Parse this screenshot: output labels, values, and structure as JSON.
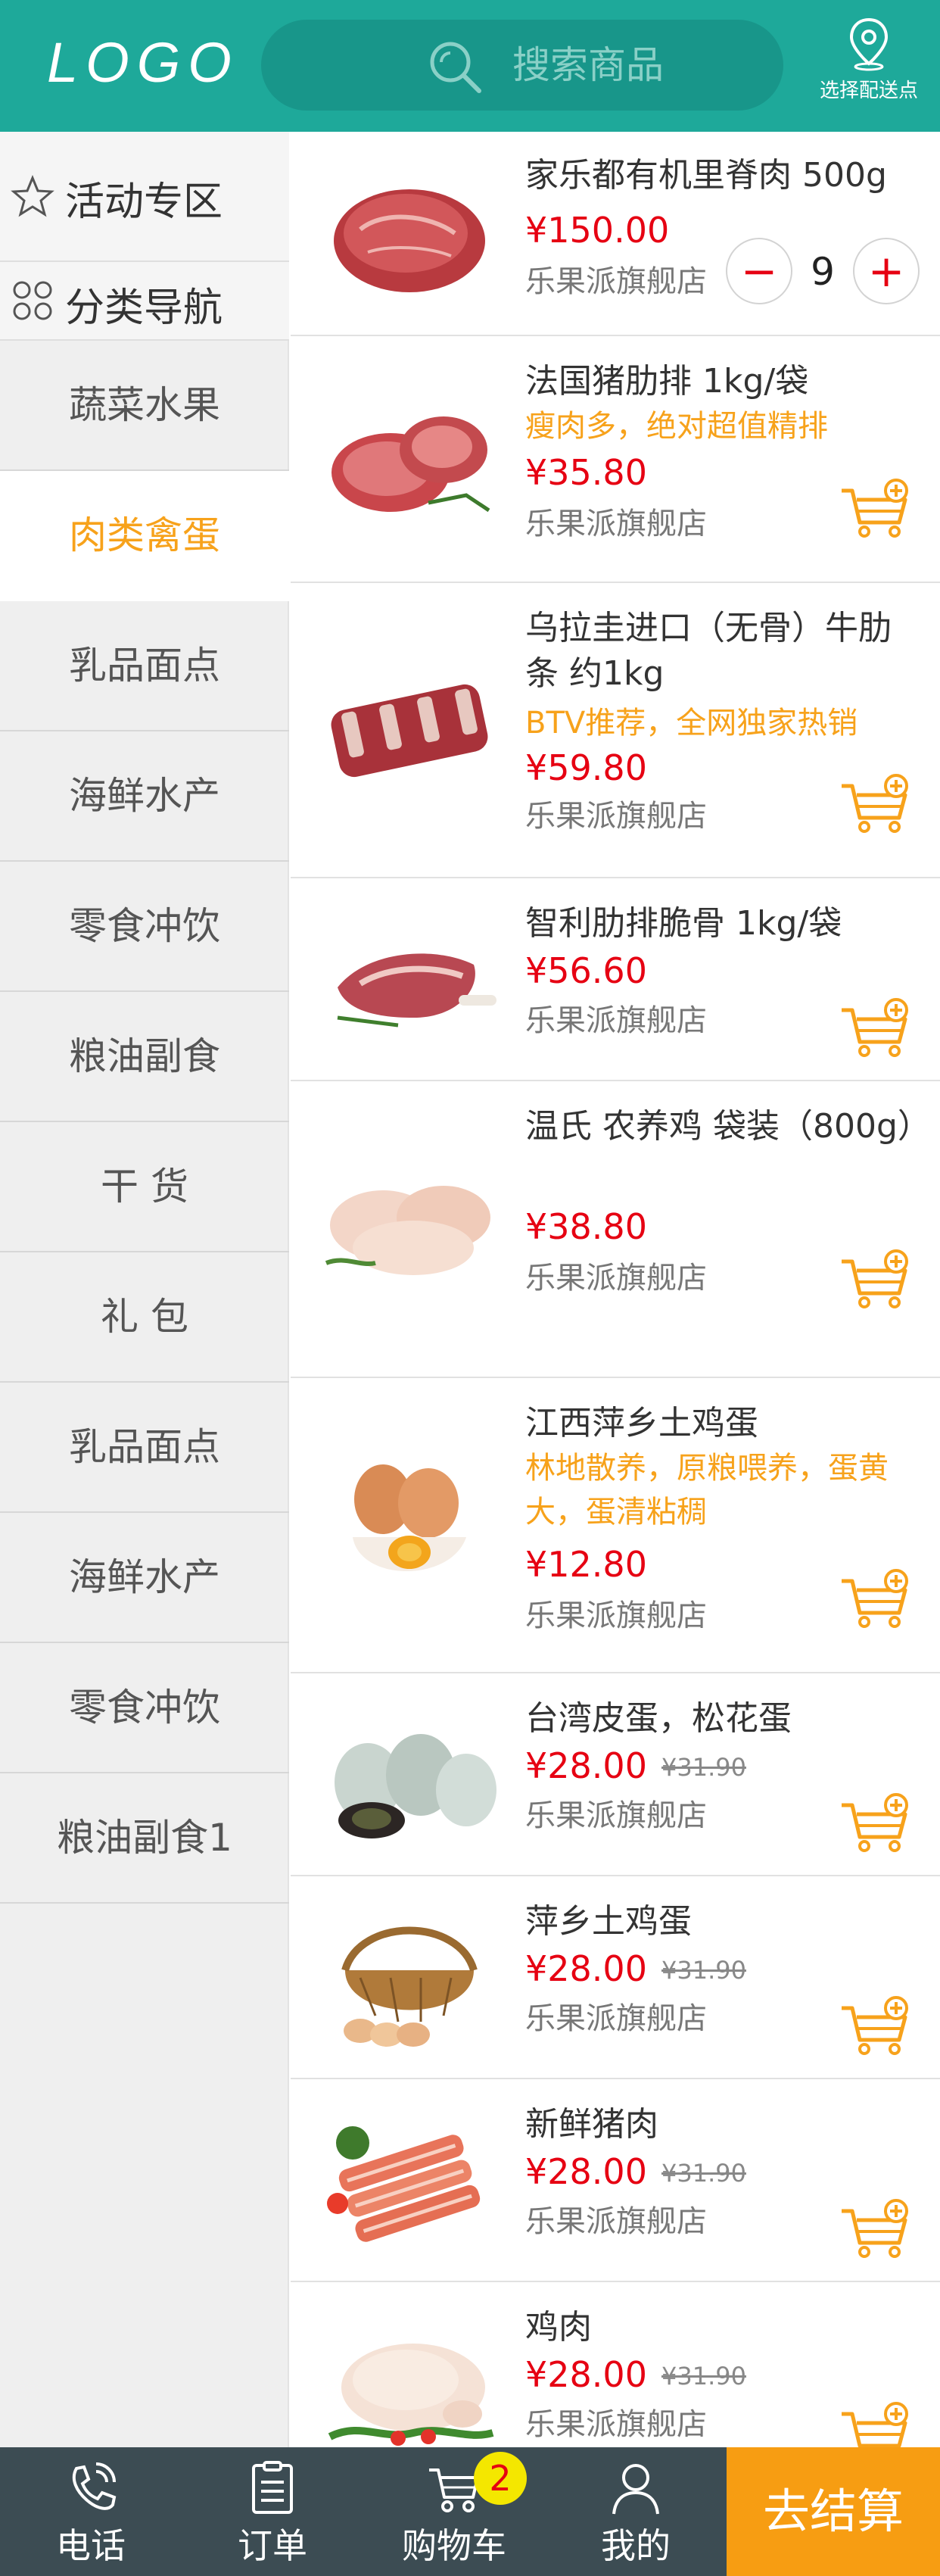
{
  "header": {
    "logo": "LOGO",
    "search_placeholder": "搜索商品",
    "deliver_label": "选择配送点"
  },
  "sidebar": {
    "activity_label": "活动专区",
    "nav_label": "分类导航",
    "categories": [
      "蔬菜水果",
      "肉类禽蛋",
      "乳品面点",
      "海鲜水产",
      "零食冲饮",
      "粮油副食",
      "干 货",
      "礼 包",
      "乳品面点",
      "海鲜水产",
      "零食冲饮",
      "粮油副食1"
    ],
    "active_index": 1
  },
  "products": [
    {
      "name": "家乐都有机里脊肉 500g",
      "promo": "",
      "price": "¥150.00",
      "old_price": "",
      "shop": "乐果派旗舰店",
      "image": "pork-loin",
      "quantity": "9"
    },
    {
      "name": "法国猪肋排 1kg/袋",
      "promo": "瘦肉多，绝对超值精排",
      "price": "¥35.80",
      "old_price": "",
      "shop": "乐果派旗舰店",
      "image": "pork-chop"
    },
    {
      "name": "乌拉圭进口（无骨）牛肋条 约1kg",
      "promo": "BTV推荐，全网独家热销",
      "price": "¥59.80",
      "old_price": "",
      "shop": "乐果派旗舰店",
      "image": "beef-rib"
    },
    {
      "name": "智利肋排脆骨 1kg/袋",
      "promo": "",
      "price": "¥56.60",
      "old_price": "",
      "shop": "乐果派旗舰店",
      "image": "rib-cartilage"
    },
    {
      "name": "温氏 农养鸡 袋装（800g）",
      "promo": "",
      "price": "¥38.80",
      "old_price": "",
      "shop": "乐果派旗舰店",
      "image": "chicken-legs"
    },
    {
      "name": "江西萍乡土鸡蛋",
      "promo": "林地散养，原粮喂养，蛋黄大，蛋清粘稠",
      "price": "¥12.80",
      "old_price": "",
      "shop": "乐果派旗舰店",
      "image": "eggs"
    },
    {
      "name": "台湾皮蛋，松花蛋",
      "promo": "",
      "price": "¥28.00",
      "old_price": "¥31.90",
      "shop": "乐果派旗舰店",
      "image": "century-eggs"
    },
    {
      "name": "萍乡土鸡蛋",
      "promo": "",
      "price": "¥28.00",
      "old_price": "¥31.90",
      "shop": "乐果派旗舰店",
      "image": "egg-basket"
    },
    {
      "name": "新鲜猪肉",
      "promo": "",
      "price": "¥28.00",
      "old_price": "¥31.90",
      "shop": "乐果派旗舰店",
      "image": "sliced-meat"
    },
    {
      "name": "鸡肉",
      "promo": "",
      "price": "¥28.00",
      "old_price": "¥31.90",
      "shop": "乐果派旗舰店",
      "image": "whole-chicken"
    }
  ],
  "bottom_nav": {
    "items": [
      {
        "label": "电话",
        "icon": "phone-icon"
      },
      {
        "label": "订单",
        "icon": "order-icon"
      },
      {
        "label": "购物车",
        "icon": "cart-icon"
      },
      {
        "label": "我的",
        "icon": "user-icon"
      }
    ],
    "cart_badge": "2",
    "checkout_label": "去结算"
  },
  "colors": {
    "header": "#1ea99a",
    "accent": "#f7a21b",
    "price": "#e60012",
    "bottom_bar": "#3c4c53",
    "checkout": "#f79d12"
  }
}
